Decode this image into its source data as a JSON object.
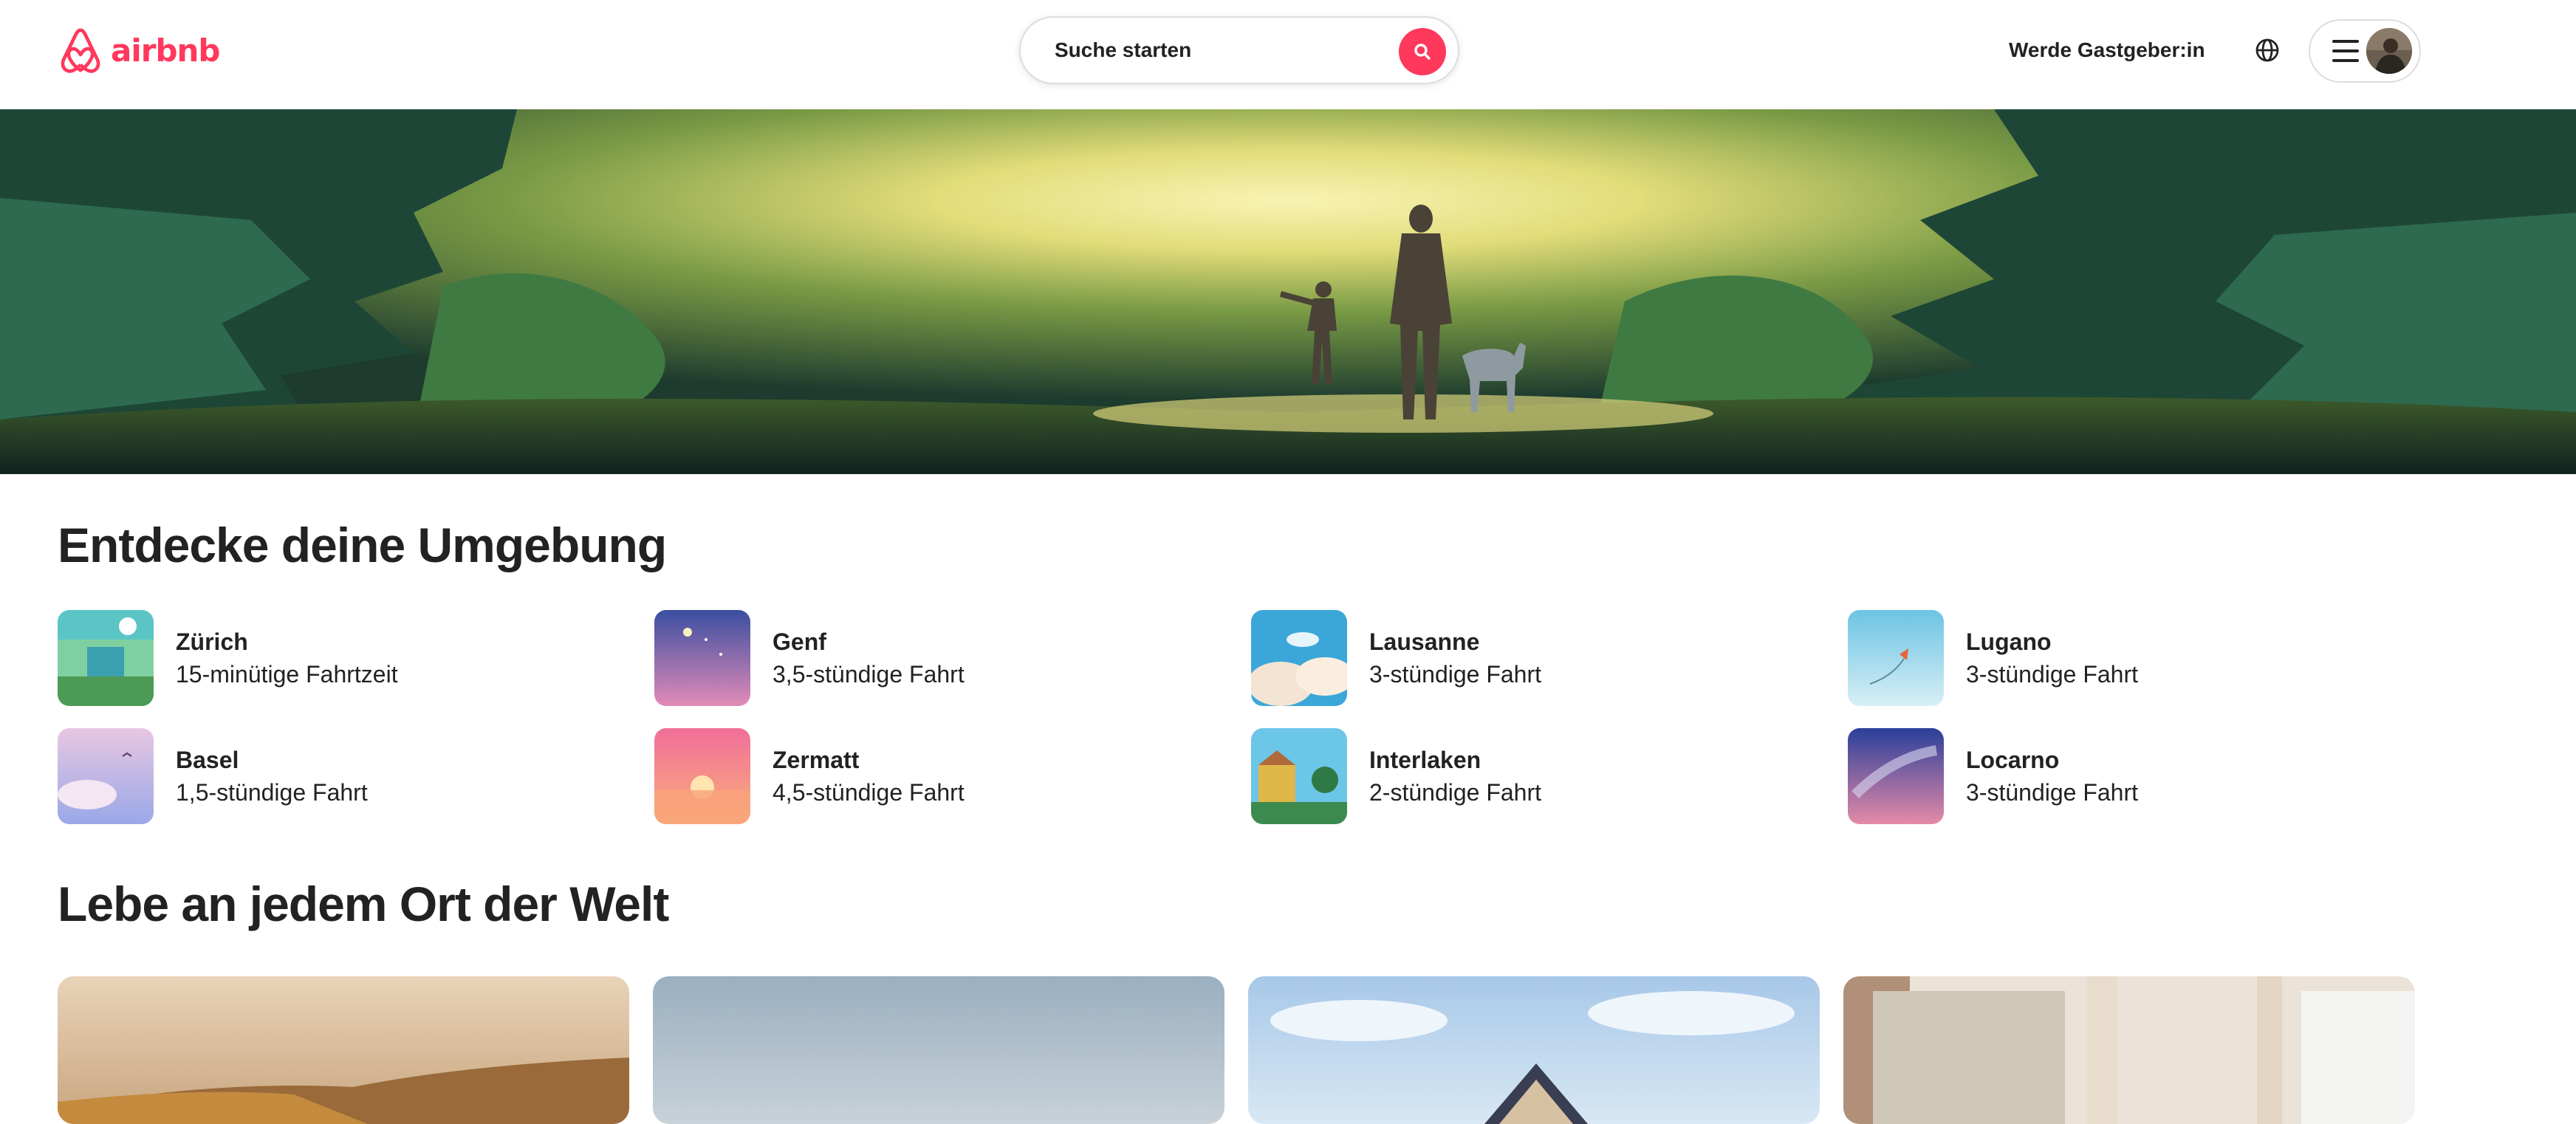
{
  "header": {
    "logo_text": "airbnb",
    "logo_icon": "airbnb-belo-icon",
    "search_placeholder": "Suche starten",
    "search_icon": "search-icon",
    "host_link": "Werde Gastgeber:in",
    "globe_icon": "globe-icon",
    "menu_icon": "hamburger-menu-icon",
    "avatar_icon": "user-avatar"
  },
  "hero": {
    "image": "forest-illustration-parent-child-dog"
  },
  "nearby": {
    "title": "Entdecke deine Umgebung",
    "items": [
      {
        "name": "Zürich",
        "time": "15-minütige Fahrtzeit"
      },
      {
        "name": "Genf",
        "time": "3,5-stündige Fahrt"
      },
      {
        "name": "Lausanne",
        "time": "3-stündige Fahrt"
      },
      {
        "name": "Lugano",
        "time": "3-stündige Fahrt"
      },
      {
        "name": "Basel",
        "time": "1,5-stündige Fahrt"
      },
      {
        "name": "Zermatt",
        "time": "4,5-stündige Fahrt"
      },
      {
        "name": "Interlaken",
        "time": "2-stündige Fahrt"
      },
      {
        "name": "Locarno",
        "time": "3-stündige Fahrt"
      }
    ]
  },
  "live_anywhere": {
    "title": "Lebe an jedem Ort der Welt",
    "cards": [
      "outdoor-getaways-photo",
      "unique-stays-photo",
      "entire-homes-photo",
      "pets-allowed-photo"
    ]
  },
  "colors": {
    "brand": "#FF385C",
    "text": "#222222",
    "border": "#DDDDDD"
  }
}
